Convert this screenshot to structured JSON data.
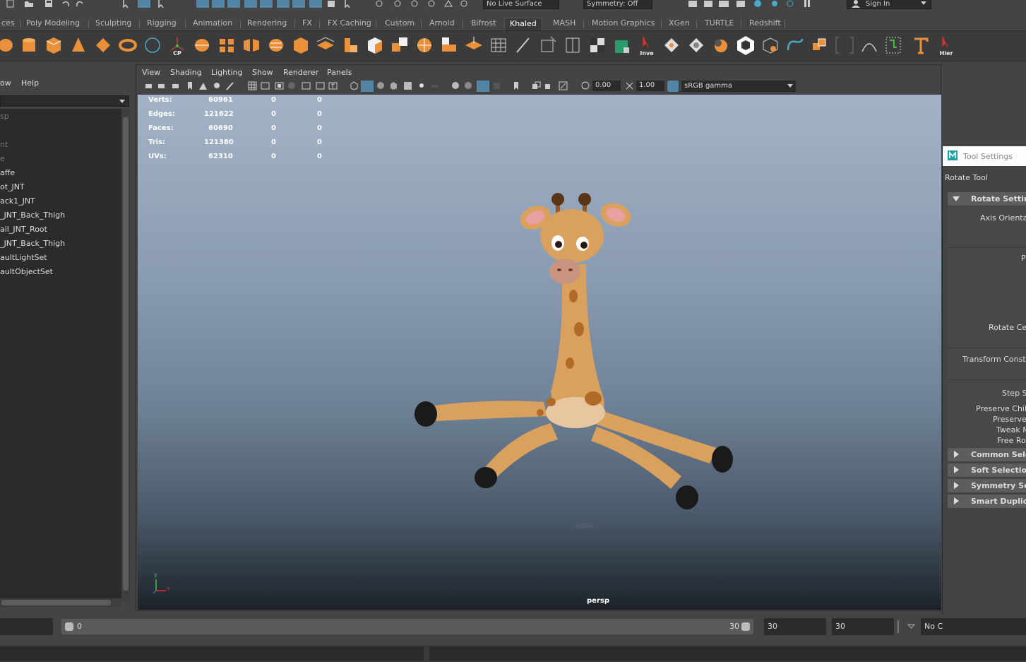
{
  "status_line": {
    "live_surface": "No Live Surface",
    "symmetry": "Symmetry: Off",
    "sign_in": "Sign In"
  },
  "shelf_tabs": [
    "ces",
    "Poly Modeling",
    "Sculpting",
    "Rigging",
    "Animation",
    "Rendering",
    "FX",
    "FX Caching",
    "Custom",
    "Arnold",
    "Bifrost",
    "Khaled",
    "MASH",
    "Motion Graphics",
    "XGen",
    "TURTLE",
    "Redshift"
  ],
  "active_shelf_tab": "Khaled",
  "shelf_icon_labels": {
    "cp": "CP",
    "inve": "Inve",
    "hier": "Hier"
  },
  "outliner": {
    "menu": [
      "ow",
      "Help"
    ],
    "items": [
      "sp",
      "",
      "nt",
      "e",
      "affe",
      "ot_JNT",
      "ack1_JNT",
      "_JNT_Back_Thigh",
      "ail_JNT_Root",
      "_JNT_Back_Thigh",
      "aultLightSet",
      "aultObjectSet"
    ]
  },
  "viewport": {
    "menu": [
      "View",
      "Shading",
      "Lighting",
      "Show",
      "Renderer",
      "Panels"
    ],
    "exposure": "0.00",
    "gamma": "1.00",
    "color_space": "sRGB gamma",
    "camera": "persp",
    "axis_y": "y",
    "axis_x": "x",
    "hud": [
      {
        "label": "Verts:",
        "total": "60961",
        "sel": "0",
        "comp": "0"
      },
      {
        "label": "Edges:",
        "total": "121622",
        "sel": "0",
        "comp": "0"
      },
      {
        "label": "Faces:",
        "total": "60690",
        "sel": "0",
        "comp": "0"
      },
      {
        "label": "Tris:",
        "total": "121380",
        "sel": "0",
        "comp": "0"
      },
      {
        "label": "UVs:",
        "total": "62310",
        "sel": "0",
        "comp": "0"
      }
    ]
  },
  "tool_settings": {
    "window_title": "Tool Settings",
    "tool_name": "Rotate Tool",
    "section_open": "Rotate Settings",
    "labels": [
      "Axis Orientat",
      "Pi",
      "Rotate Cer",
      "Transform Constra",
      "Step Sn",
      "Preserve Child",
      "Preserve U",
      "Tweak Mo",
      "Free Rot"
    ],
    "sections_closed": [
      "Common Select",
      "Soft Selection",
      "Symmetry Setti",
      "Smart Duplicate"
    ]
  },
  "range": {
    "start": "0",
    "end": "30",
    "anim_end": "30",
    "anim_end2": "30",
    "no_char": "No C"
  },
  "colors": {
    "accent": "#5285a6",
    "giraffe_body": "#d9a05e",
    "giraffe_spot": "#b26a2a"
  }
}
